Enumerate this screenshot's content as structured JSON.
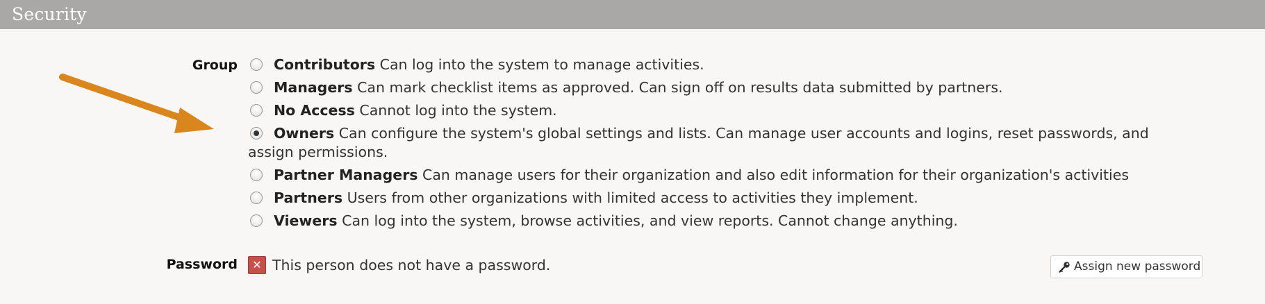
{
  "section": {
    "title": "Security"
  },
  "group_field": {
    "label": "Group",
    "options": [
      {
        "name": "Contributors",
        "description": "Can log into the system to manage activities.",
        "selected": false
      },
      {
        "name": "Managers",
        "description": "Can mark checklist items as approved. Can sign off on results data submitted by partners.",
        "selected": false
      },
      {
        "name": "No Access",
        "description": "Cannot log into the system.",
        "selected": false
      },
      {
        "name": "Owners",
        "description": "Can configure the system's global settings and lists. Can manage user accounts and logins, reset passwords, and assign permissions.",
        "selected": true
      },
      {
        "name": "Partner Managers",
        "description": "Can manage users for their organization and also edit information for their organization's activities",
        "selected": false
      },
      {
        "name": "Partners",
        "description": "Users from other organizations with limited access to activities they implement.",
        "selected": false
      },
      {
        "name": "Viewers",
        "description": "Can log into the system, browse activities, and view reports. Cannot change anything.",
        "selected": false
      }
    ]
  },
  "password_field": {
    "label": "Password",
    "status_icon": "x-icon",
    "status_glyph": "✕",
    "status_text": "This person does not have a password.",
    "assign_button_label": "Assign new password",
    "assign_button_icon": "key-icon"
  },
  "colors": {
    "header_bg": "#a9a8a6",
    "arrow": "#d9861c",
    "status_error": "#c8504b"
  }
}
